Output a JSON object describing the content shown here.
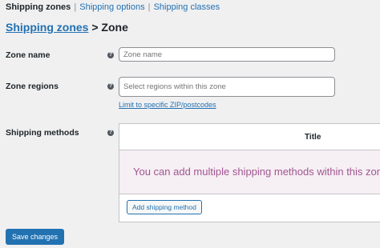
{
  "subnav": {
    "current": "Shipping zones",
    "options": "Shipping options",
    "classes": "Shipping classes",
    "separator": "|"
  },
  "breadcrumb": {
    "link": "Shipping zones",
    "rest": " > Zone"
  },
  "zone_name": {
    "label": "Zone name",
    "placeholder": "Zone name"
  },
  "zone_regions": {
    "label": "Zone regions",
    "placeholder": "Select regions within this zone",
    "zip_link": "Limit to specific ZIP/postcodes"
  },
  "shipping_methods": {
    "label": "Shipping methods",
    "column_title": "Title",
    "empty_message": "You can add multiple shipping methods within this zone.",
    "add_button": "Add shipping method"
  },
  "help_icon": "help-icon",
  "help_glyph": "?",
  "save_button": "Save changes",
  "colors": {
    "accent": "#2271b1",
    "background": "#f0f0f1",
    "empty_row_bg": "#f6eff3",
    "empty_text": "#a15693"
  }
}
